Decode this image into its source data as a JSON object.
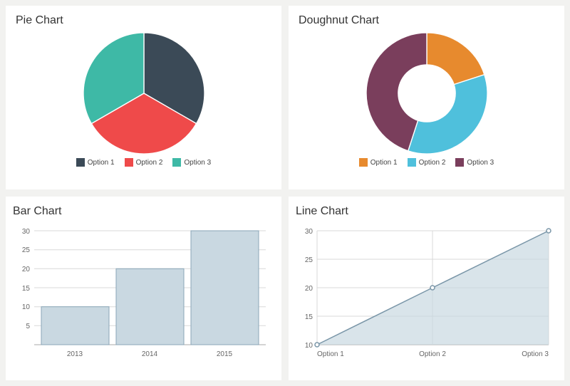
{
  "pie": {
    "title": "Pie Chart",
    "legend": [
      "Option 1",
      "Option 2",
      "Option 3"
    ],
    "colors": [
      "#3b4a57",
      "#ef4a4a",
      "#3eb9a6"
    ]
  },
  "doughnut": {
    "title": "Doughnut Chart",
    "legend": [
      "Option 1",
      "Option 2",
      "Option 3"
    ],
    "colors": [
      "#e78a2e",
      "#4fc0dc",
      "#7a3e5c"
    ]
  },
  "bar": {
    "title": "Bar Chart",
    "yticks": [
      "30",
      "25",
      "20",
      "15",
      "10",
      "5"
    ],
    "xlabels": [
      "2013",
      "2014",
      "2015"
    ]
  },
  "line": {
    "title": "Line Chart",
    "yticks": [
      "30",
      "25",
      "20",
      "15",
      "10"
    ],
    "xlabels": [
      "Option 1",
      "Option 2",
      "Option 3"
    ]
  },
  "chart_data": [
    {
      "type": "pie",
      "title": "Pie Chart",
      "categories": [
        "Option 1",
        "Option 2",
        "Option 3"
      ],
      "values": [
        33.3,
        33.3,
        33.3
      ],
      "colors": [
        "#3b4a57",
        "#ef4a4a",
        "#3eb9a6"
      ]
    },
    {
      "type": "pie",
      "title": "Doughnut Chart",
      "categories": [
        "Option 1",
        "Option 2",
        "Option 3"
      ],
      "values": [
        20,
        35,
        45
      ],
      "colors": [
        "#e78a2e",
        "#4fc0dc",
        "#7a3e5c"
      ],
      "doughnut": true
    },
    {
      "type": "bar",
      "title": "Bar Chart",
      "categories": [
        "2013",
        "2014",
        "2015"
      ],
      "values": [
        10,
        20,
        30
      ],
      "ylim": [
        0,
        30
      ],
      "xlabel": "",
      "ylabel": ""
    },
    {
      "type": "area",
      "title": "Line Chart",
      "categories": [
        "Option 1",
        "Option 2",
        "Option 3"
      ],
      "values": [
        10,
        20,
        30
      ],
      "ylim": [
        10,
        30
      ],
      "xlabel": "",
      "ylabel": ""
    }
  ]
}
